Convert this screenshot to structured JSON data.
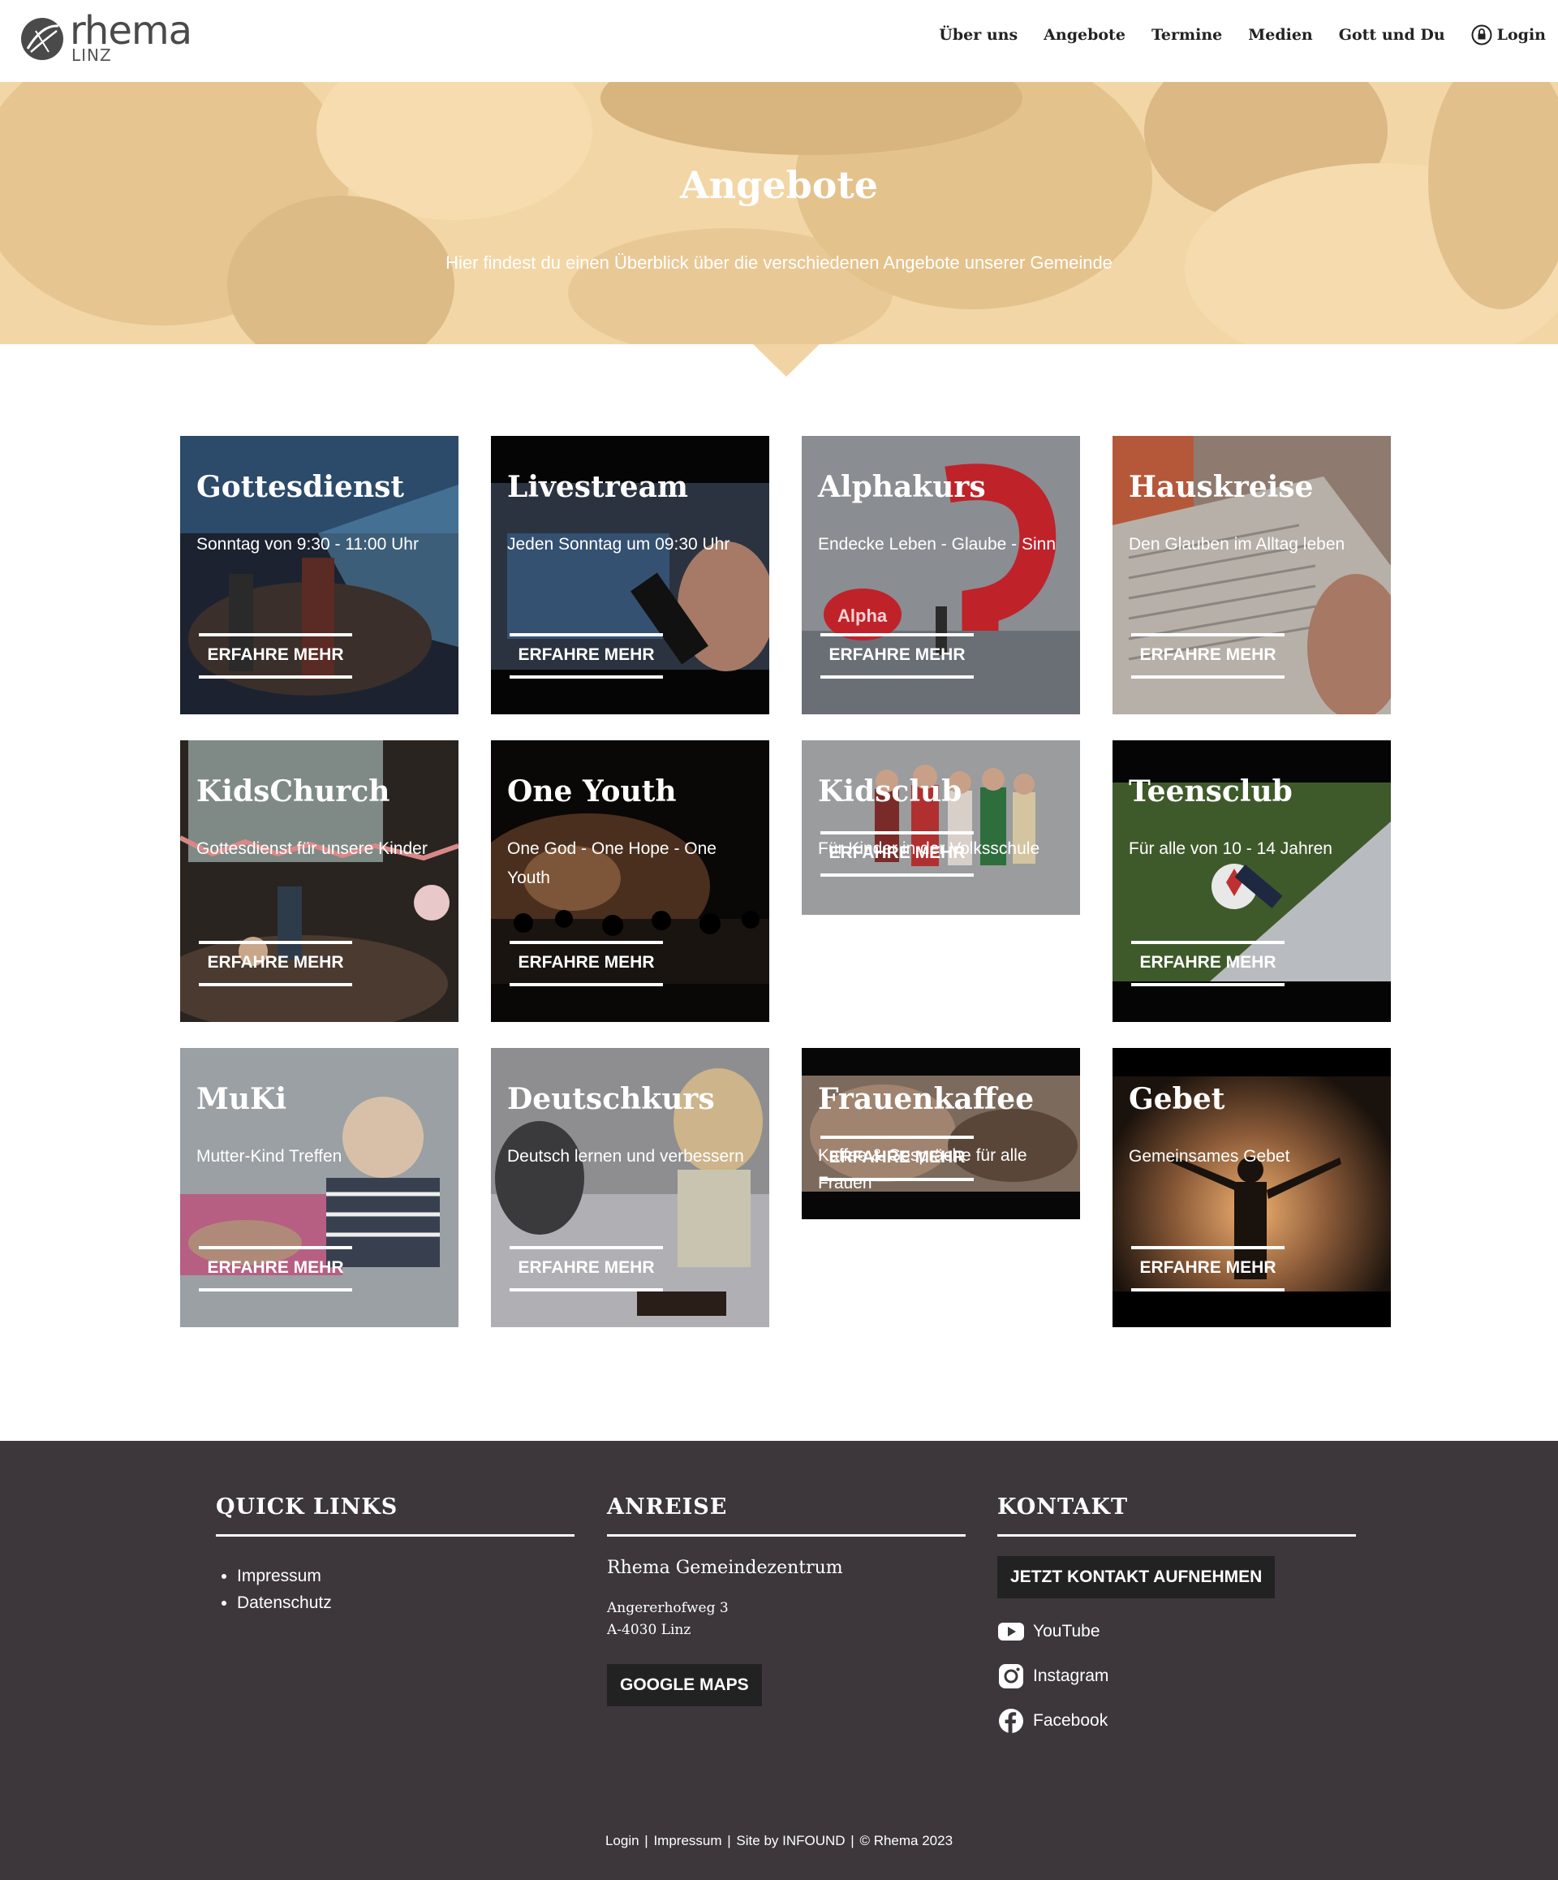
{
  "header": {
    "logo_word": "rhema",
    "logo_sub": "LINZ",
    "nav": [
      {
        "label": "Über uns"
      },
      {
        "label": "Angebote"
      },
      {
        "label": "Termine"
      },
      {
        "label": "Medien"
      },
      {
        "label": "Gott und Du"
      }
    ],
    "login_label": "Login"
  },
  "hero": {
    "title": "Angebote",
    "subtitle": "Hier findest du einen Überblick über die verschiedenen Angebote unserer Gemeinde",
    "tint_color": "#f2d4a4"
  },
  "cards": [
    {
      "title": "Gottesdienst",
      "subtitle": "Sonntag von 9:30 - 11:00 Uhr",
      "button": "ERFAHRE MEHR"
    },
    {
      "title": "Livestream",
      "subtitle": "Jeden Sonntag um 09:30 Uhr",
      "button": "ERFAHRE MEHR"
    },
    {
      "title": "Alphakurs",
      "subtitle": "Endecke Leben - Glaube - Sinn",
      "button": "ERFAHRE MEHR",
      "badge": "Alpha"
    },
    {
      "title": "Hauskreise",
      "subtitle": "Den Glauben im Alltag leben",
      "button": "ERFAHRE MEHR"
    },
    {
      "title": "KidsChurch",
      "subtitle": "Gottesdienst für unsere Kinder",
      "button": "ERFAHRE MEHR"
    },
    {
      "title": "One Youth",
      "subtitle": "One God - One Hope - One Youth",
      "button": "ERFAHRE MEHR"
    },
    {
      "title": "Kidsclub",
      "subtitle": "Für Kinder in der Volksschule",
      "button": "ERFAHRE MEHR"
    },
    {
      "title": "Teensclub",
      "subtitle": "Für alle von 10 - 14 Jahren",
      "button": "ERFAHRE MEHR"
    },
    {
      "title": "MuKi",
      "subtitle": "Mutter-Kind Treffen",
      "button": "ERFAHRE MEHR"
    },
    {
      "title": "Deutschkurs",
      "subtitle": "Deutsch lernen und verbessern",
      "button": "ERFAHRE MEHR"
    },
    {
      "title": "Frauenkaffee",
      "subtitle": "Kaffee & Gespräche für alle Frauen",
      "button": "ERFAHRE MEHR"
    },
    {
      "title": "Gebet",
      "subtitle": "Gemeinsames Gebet",
      "button": "ERFAHRE MEHR"
    }
  ],
  "footer": {
    "quick_links": {
      "heading": "QUICK LINKS",
      "items": [
        "Impressum",
        "Datenschutz"
      ]
    },
    "anreise": {
      "heading": "ANREISE",
      "venue": "Rhema Gemeindezentrum",
      "street": "Angererhofweg 3",
      "city": "A-4030 Linz",
      "button": "GOOGLE MAPS"
    },
    "kontakt": {
      "heading": "KONTAKT",
      "button": "JETZT KONTAKT AUFNEHMEN",
      "social": [
        "YouTube",
        "Instagram",
        "Facebook"
      ]
    },
    "bottom": {
      "login": "Login",
      "impressum": "Impressum",
      "credit": "Site by INFOUND",
      "copyright": "© Rhema 2023",
      "sep": "|"
    }
  },
  "colors": {
    "footer_bg": "#3d373b",
    "button_dark": "#222222",
    "hero_tint": "#f2d4a4"
  }
}
